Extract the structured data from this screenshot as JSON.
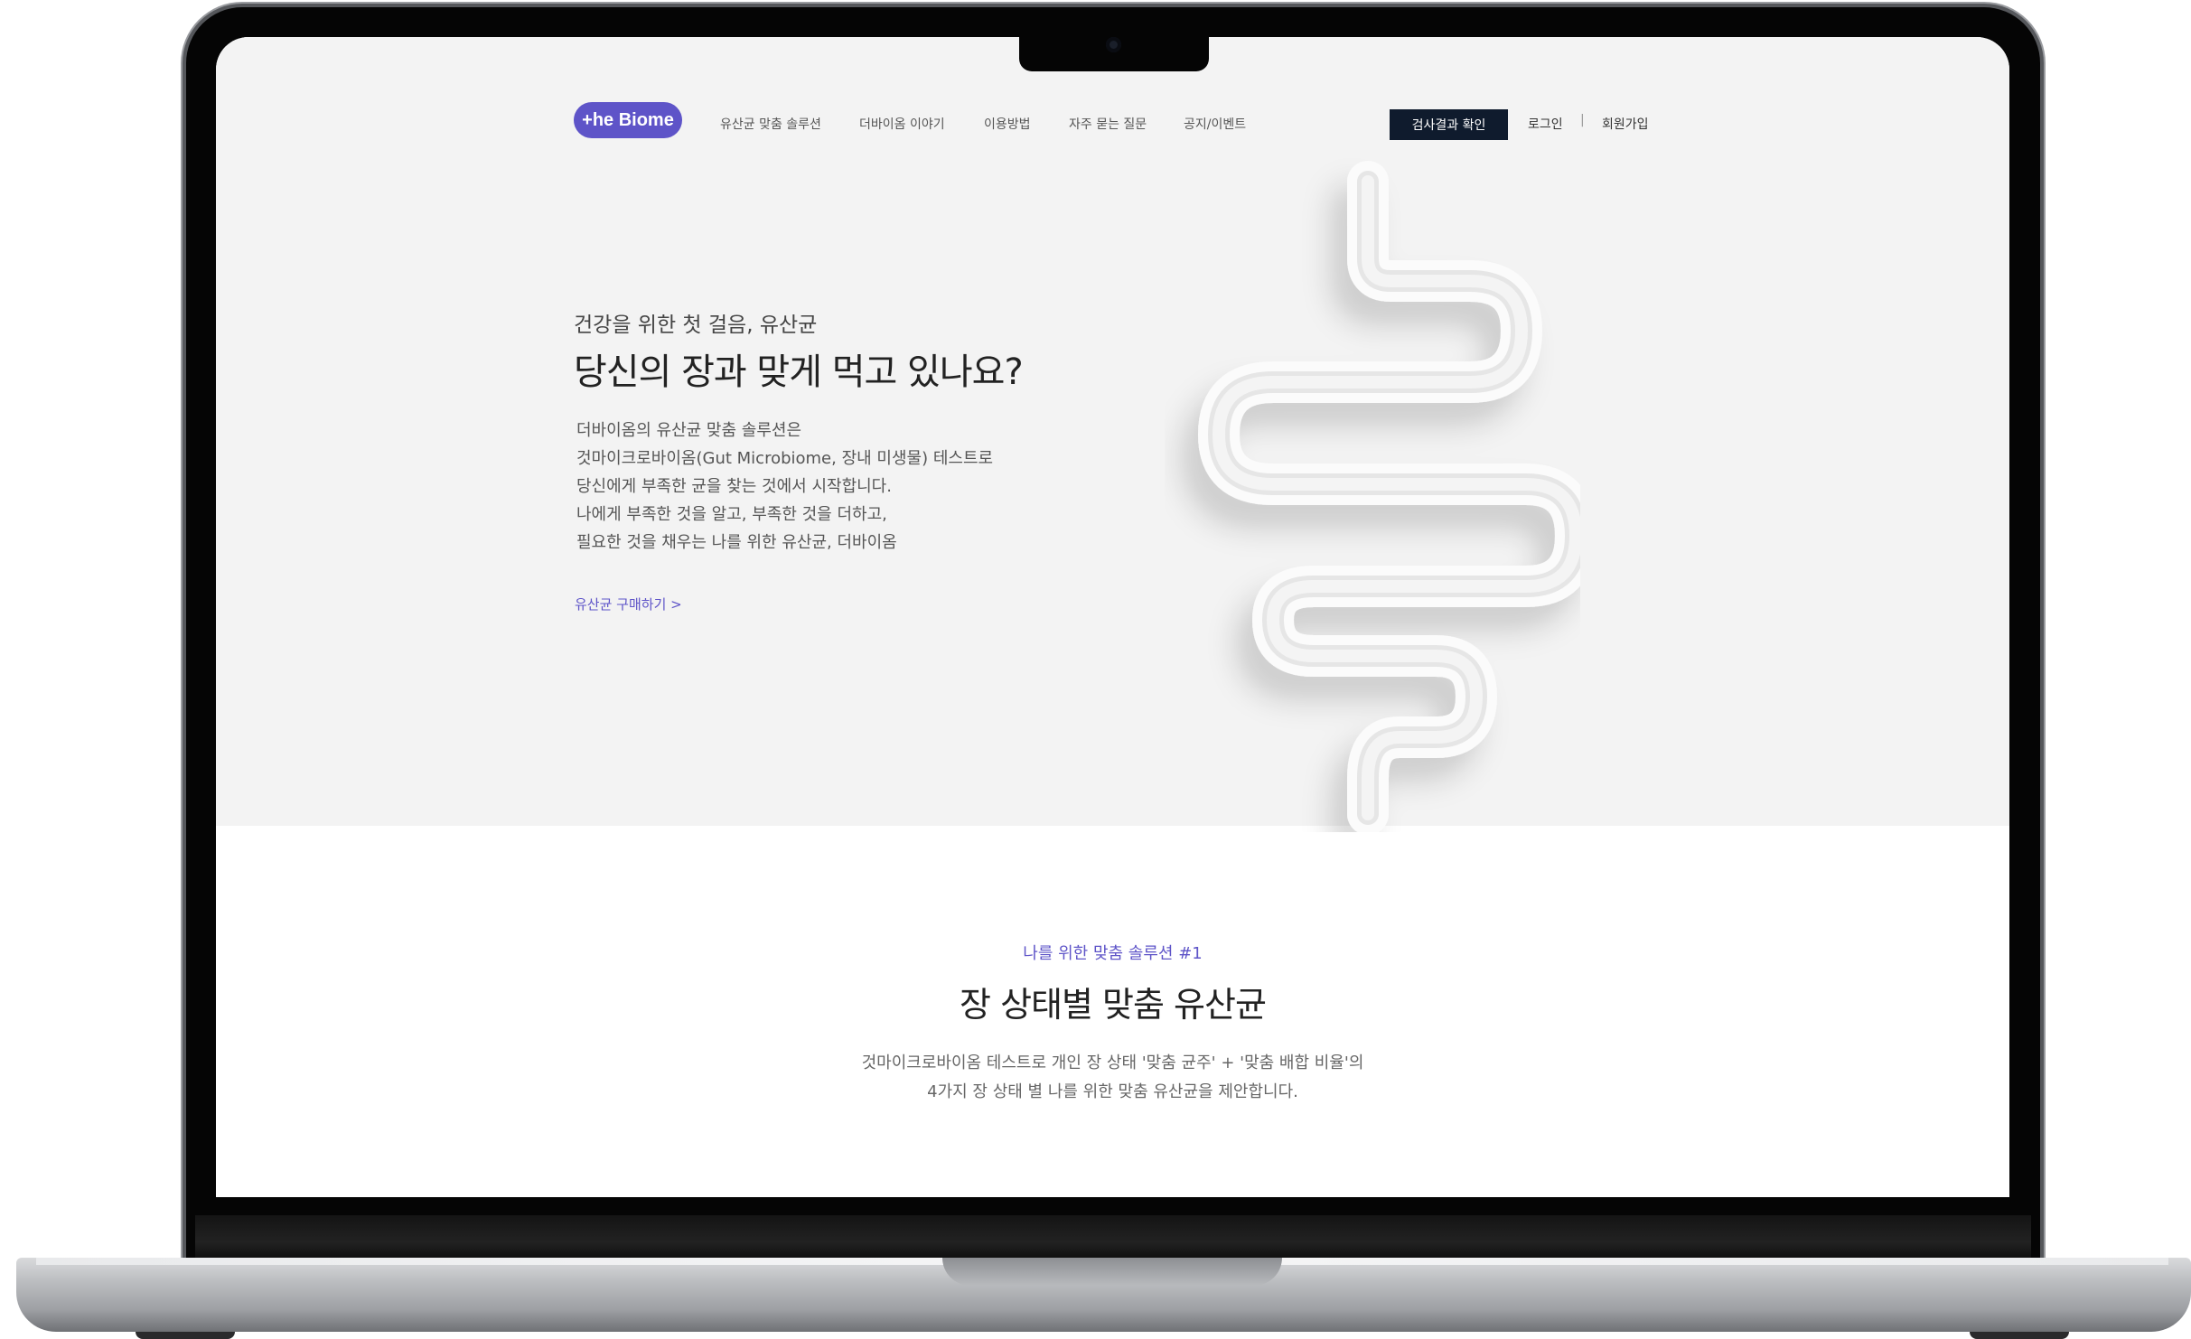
{
  "header": {
    "logo_text": "+he Biome",
    "nav": [
      "유산균 맞춤 솔루션",
      "더바이옴 이야기",
      "이용방법",
      "자주 묻는 질문",
      "공지/이벤트"
    ],
    "result_button": "검사결과 확인",
    "login": "로그인",
    "separator": "|",
    "signup": "회원가입"
  },
  "hero": {
    "subtitle": "건강을 위한 첫 걸음, 유산균",
    "title": "당신의 장과 맞게 먹고 있나요?",
    "description": [
      "더바이옴의 유산균 맞춤 솔루션은",
      "것마이크로바이옴(Gut Microbiome, 장내 미생물) 테스트로",
      "당신에게 부족한 균을 찾는 것에서 시작합니다.",
      "나에게 부족한 것을 알고, 부족한 것을 더하고,",
      "필요한 것을 채우는 나를 위한 유산균, 더바이옴"
    ],
    "buy_link": "유산균 구매하기  >"
  },
  "section": {
    "kicker": "나를 위한 맞춤 솔루션 #1",
    "title": "장 상태별 맞춤 유산균",
    "description": [
      "것마이크로바이옴 테스트로 개인 장 상태 '맞춤 균주' + '맞춤 배합 비율'의",
      "4가지 장 상태 별 나를 위한 맞춤 유산균을 제안합니다."
    ]
  },
  "colors": {
    "accent": "#5e54c8",
    "button_dark": "#0f1b2d",
    "hero_bg": "#f3f3f3"
  },
  "icons": {
    "logo": "the-biome-logo",
    "illustration": "intestine-illustration"
  }
}
